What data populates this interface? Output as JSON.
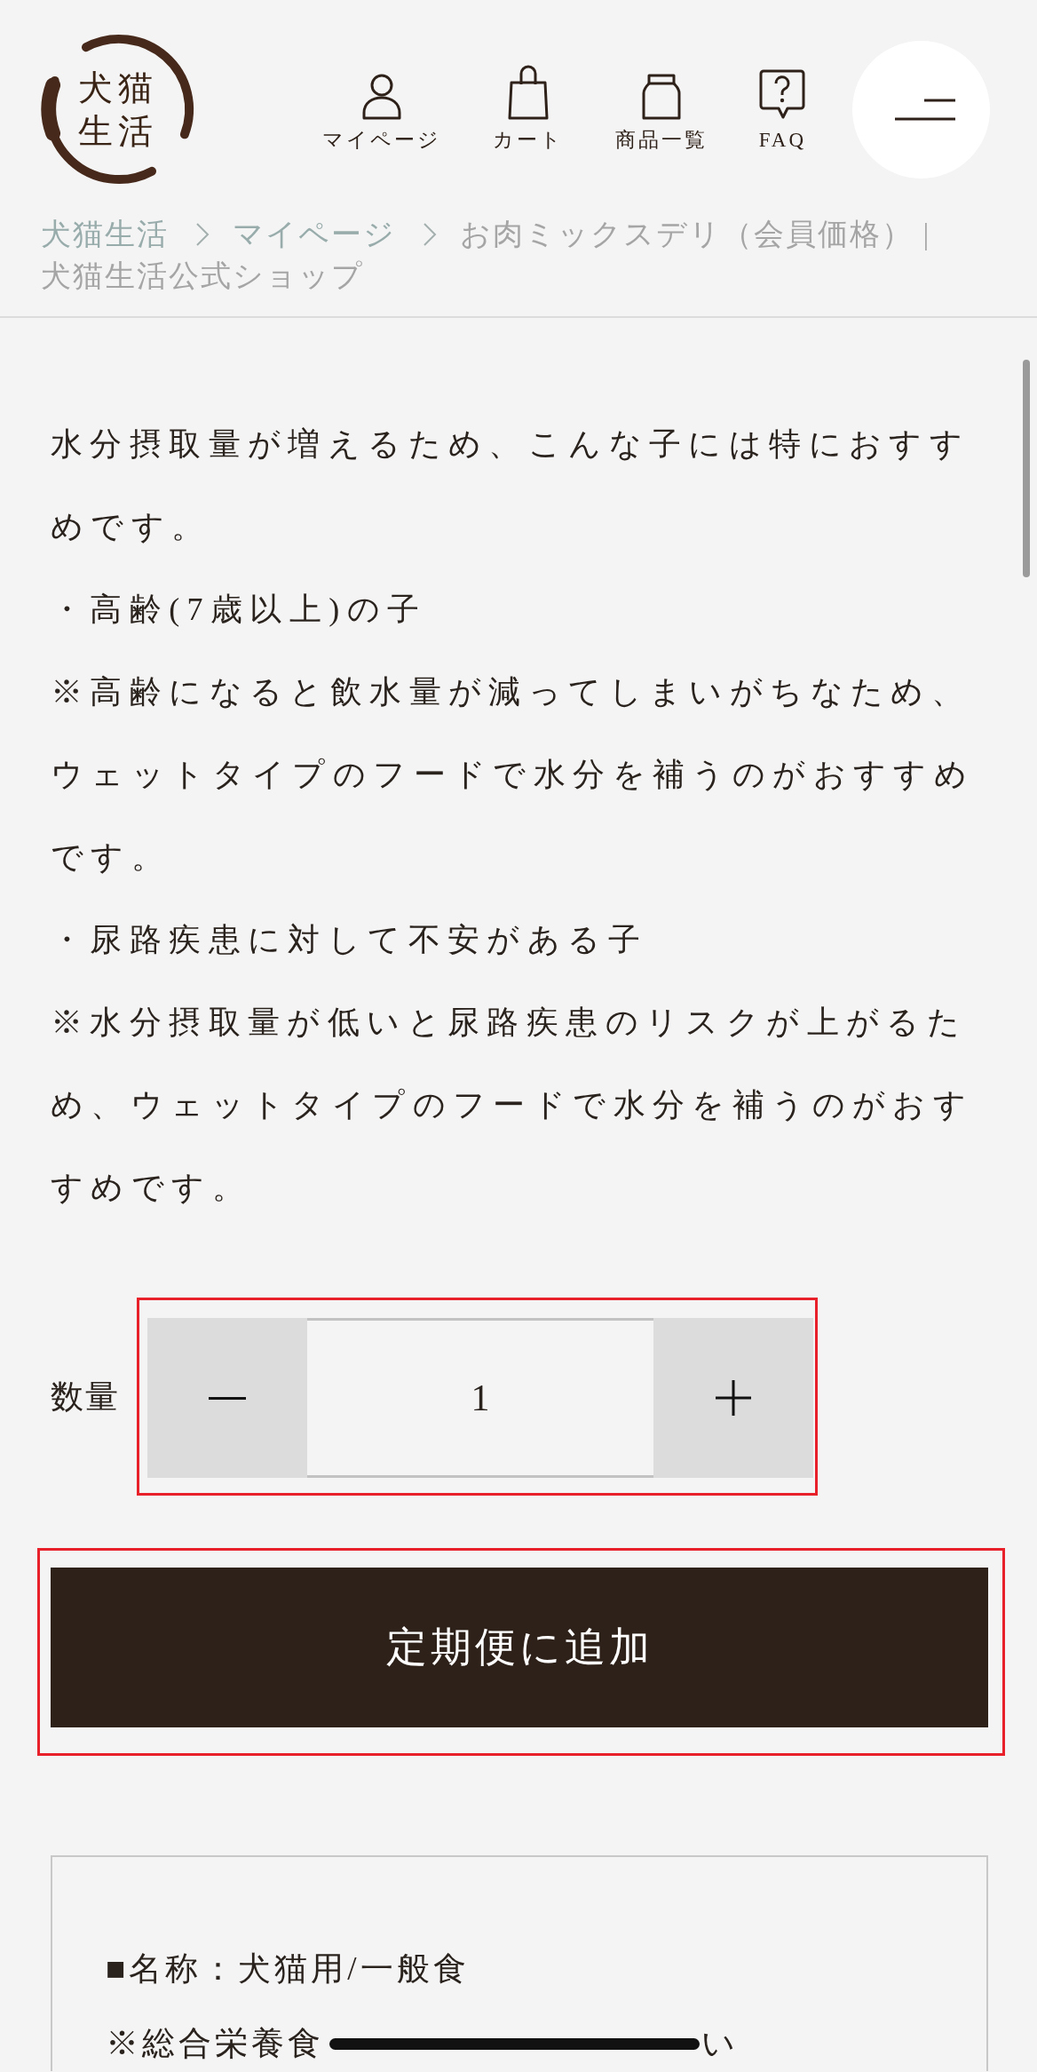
{
  "header": {
    "logo": {
      "lines": [
        "犬猫",
        "生活"
      ]
    },
    "nav": [
      {
        "label": "マイページ",
        "kind": "account"
      },
      {
        "label": "カート",
        "kind": "cart"
      },
      {
        "label": "商品一覧",
        "kind": "catalog"
      },
      {
        "label": "FAQ",
        "kind": "help"
      }
    ]
  },
  "breadcrumb": [
    {
      "label": "犬猫生活",
      "kind": "link"
    },
    {
      "label": "マイページ",
      "kind": "link"
    },
    {
      "kind": "current",
      "lines": [
        "お肉ミックスデリ（会員価格） |",
        "犬猫生活公式ショップ"
      ]
    }
  ],
  "description": [
    "水分摂取量が増えるため、こんな子には特におすすめです。",
    "・高齢(7歳以上)の子",
    "※高齢になると飲水量が減ってしまいがちなため、ウェットタイプのフードで水分を補うのがおすすめです。",
    "・尿路疾患に対して不安がある子",
    "※水分摂取量が低いと尿路疾患のリスクが上がるため、ウェットタイプのフードで水分を補うのがおすすめです。"
  ],
  "quantity": {
    "label": "数量",
    "value": "1",
    "highlighted": true
  },
  "add_button": {
    "label": "定期便に追加",
    "highlighted": true
  },
  "spec": {
    "lines": [
      {
        "text": "■名称：犬猫用/一般食",
        "scribbled": false
      },
      {
        "text": "※総合栄養食",
        "scribbled": true,
        "tail": "い"
      }
    ]
  }
}
